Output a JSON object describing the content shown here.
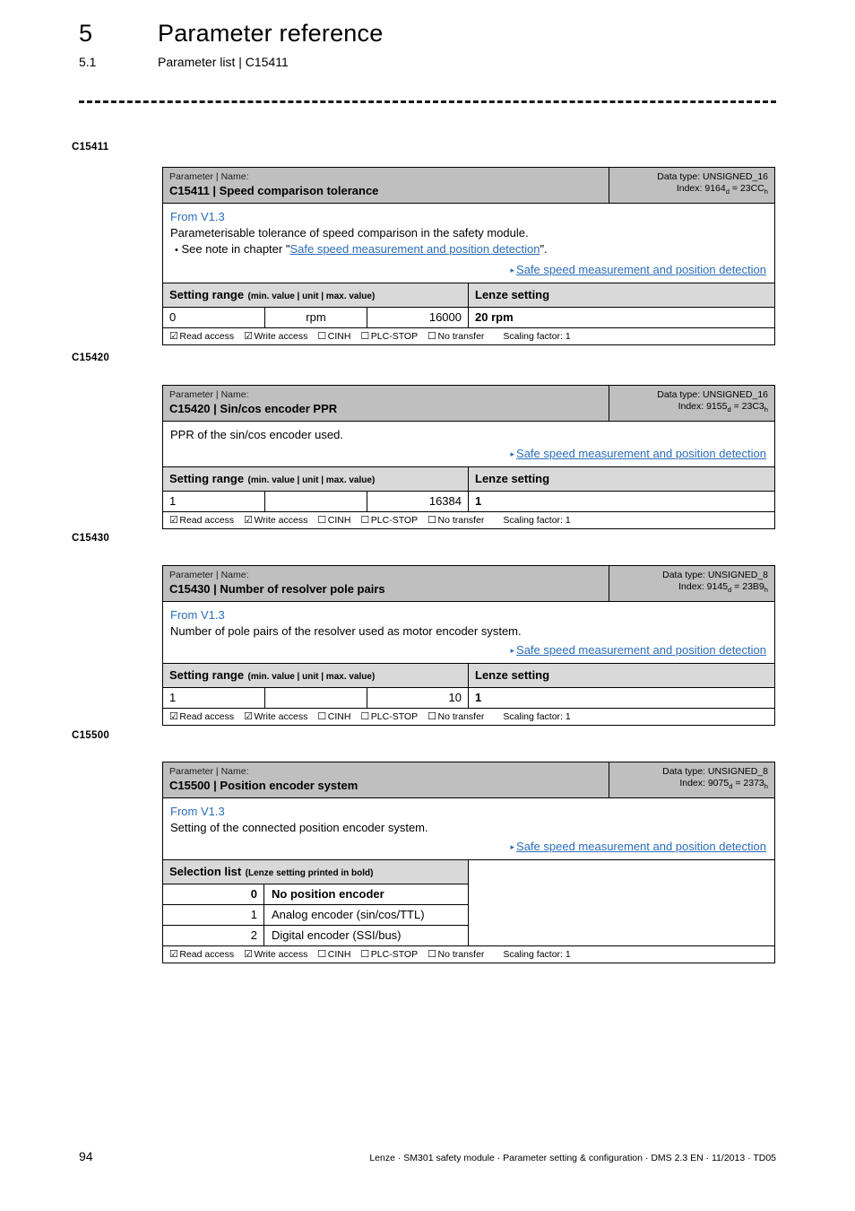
{
  "header": {
    "chapter_number": "5",
    "chapter_title": "Parameter reference",
    "section_number": "5.1",
    "section_title": "Parameter list | C15411"
  },
  "labels": {
    "parameter_label": "Parameter | Name:",
    "setting_range": "Setting range",
    "setting_range_hint": "(min. value | unit | max. value)",
    "lenze_setting": "Lenze setting",
    "selection_list": "Selection list",
    "selection_list_hint": "(Lenze setting printed in bold)",
    "read_access": "Read access",
    "write_access": "Write access",
    "cinh": "CINH",
    "plc_stop": "PLC-STOP",
    "no_transfer": "No transfer",
    "scaling_factor": "Scaling factor: 1",
    "checked_box": "☑",
    "unchecked_box": "☐",
    "triangle": "▸"
  },
  "margin_labels": [
    "C15411",
    "C15420",
    "C15430",
    "C15500"
  ],
  "parameters": [
    {
      "code": "C15411",
      "name": "Speed comparison tolerance",
      "title": "C15411 | Speed comparison tolerance",
      "data_type": "Data type: UNSIGNED_16",
      "index_prefix": "Index: 9164",
      "index_sub_d": "d",
      "index_mid": " = 23CC",
      "index_sub_h": "h",
      "version": "From V1.3",
      "description": "Parameterisable tolerance of speed comparison in the safety module.",
      "bullet_prefix": "See note in chapter \"",
      "bullet_link": "Safe speed measurement and position detection",
      "bullet_suffix": "\".",
      "xref": "Safe speed measurement and position detection",
      "min": "0",
      "unit": "rpm",
      "max": "16000",
      "lenze": "20 rpm"
    },
    {
      "code": "C15420",
      "name": "Sin/cos encoder PPR",
      "title": "C15420 | Sin/cos encoder PPR",
      "data_type": "Data type: UNSIGNED_16",
      "index_prefix": "Index: 9155",
      "index_sub_d": "d",
      "index_mid": " = 23C3",
      "index_sub_h": "h",
      "version": "",
      "description": "PPR of the sin/cos encoder used.",
      "xref": "Safe speed measurement and position detection",
      "min": "1",
      "unit": "",
      "max": "16384",
      "lenze": "1"
    },
    {
      "code": "C15430",
      "name": "Number of resolver pole pairs",
      "title": "C15430 | Number of resolver pole pairs",
      "data_type": "Data type: UNSIGNED_8",
      "index_prefix": "Index: 9145",
      "index_sub_d": "d",
      "index_mid": " = 23B9",
      "index_sub_h": "h",
      "version": "From V1.3",
      "description": "Number of pole pairs of the resolver used as motor encoder system.",
      "xref": "Safe speed measurement and position detection",
      "min": "1",
      "unit": "",
      "max": "10",
      "lenze": "1"
    },
    {
      "code": "C15500",
      "name": "Position encoder system",
      "title": "C15500 | Position encoder system",
      "data_type": "Data type: UNSIGNED_8",
      "index_prefix": "Index: 9075",
      "index_sub_d": "d",
      "index_mid": " = 2373",
      "index_sub_h": "h",
      "version": "From V1.3",
      "description": "Setting of the connected position encoder system.",
      "xref": "Safe speed measurement and position detection",
      "selection": [
        {
          "code": "0",
          "text": "No position encoder",
          "is_default": true
        },
        {
          "code": "1",
          "text": "Analog encoder (sin/cos/TTL)",
          "is_default": false
        },
        {
          "code": "2",
          "text": "Digital encoder (SSI/bus)",
          "is_default": false
        }
      ]
    }
  ],
  "footer": {
    "page_number": "94",
    "text": "Lenze · SM301 safety module · Parameter setting & configuration · DMS 2.3 EN · 11/2013 · TD05"
  }
}
